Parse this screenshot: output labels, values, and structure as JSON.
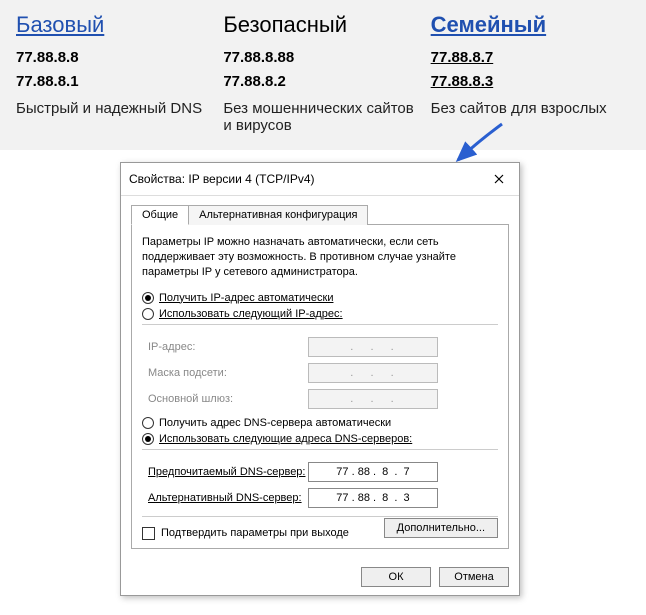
{
  "banner": {
    "cols": [
      {
        "title": "Базовый",
        "ip1": "77.88.8.8",
        "ip2": "77.88.8.1",
        "desc": "Быстрый и надежный DNS"
      },
      {
        "title": "Безопасный",
        "ip1": "77.88.8.88",
        "ip2": "77.88.8.2",
        "desc": "Без мошеннических сайтов и вирусов"
      },
      {
        "title": "Семейный",
        "ip1": "77.88.8.7",
        "ip2": "77.88.8.3",
        "desc": "Без сайтов для взрослых"
      }
    ]
  },
  "dialog": {
    "title": "Свойства: IP версии 4 (TCP/IPv4)",
    "tabs": {
      "general": "Общие",
      "alt": "Альтернативная конфигурация"
    },
    "explain": "Параметры IP можно назначать автоматически, если сеть поддерживает эту возможность. В противном случае узнайте параметры IP у сетевого администратора.",
    "ip": {
      "auto": "Получить IP-адрес автоматически",
      "manual": "Использовать следующий IP-адрес:",
      "addr_label": "IP-адрес:",
      "mask_label": "Маска подсети:",
      "gw_label": "Основной шлюз:",
      "addr_val": ".   .   .",
      "mask_val": ".   .   .",
      "gw_val": ".   .   ."
    },
    "dns": {
      "auto": "Получить адрес DNS-сервера автоматически",
      "manual": "Использовать следующие адреса DNS-серверов:",
      "pref_label": "Предпочитаемый DNS-сервер:",
      "alt_label": "Альтернативный DNS-сервер:",
      "pref_val": "77 . 88 .  8  .  7",
      "alt_val": "77 . 88 .  8  .  3"
    },
    "confirm": "Подтвердить параметры при выходе",
    "advanced": "Дополнительно...",
    "ok": "ОК",
    "cancel": "Отмена"
  }
}
